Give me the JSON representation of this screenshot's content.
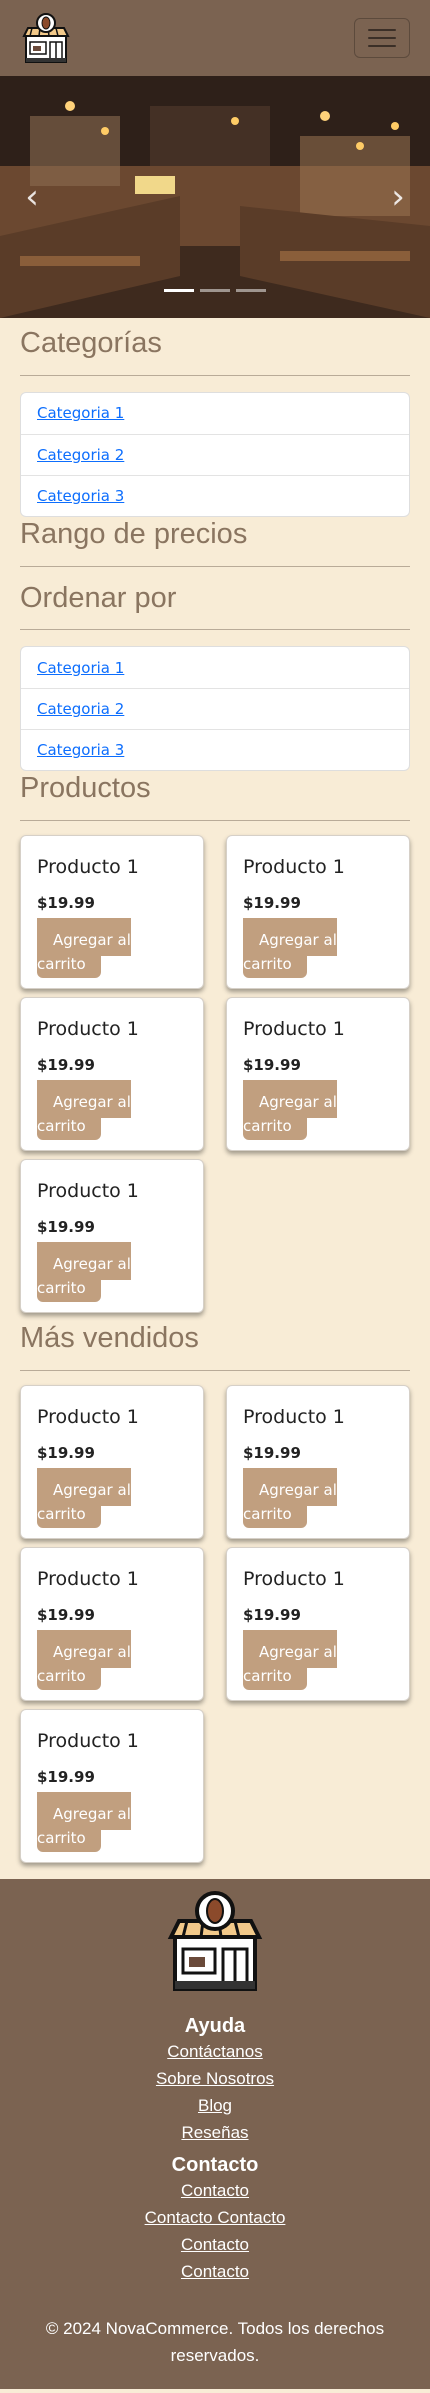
{
  "navbar": {
    "logo_icon": "coffee-shop-icon",
    "menu_icon": "hamburger-icon"
  },
  "carousel": {
    "prev_glyph": "‹",
    "next_glyph": "›",
    "slides": 3,
    "active_slide": 0
  },
  "categorias": {
    "title": "Categorías",
    "items": [
      "Categoria 1",
      "Categoria 2",
      "Categoria 3"
    ]
  },
  "rango_precios": {
    "title": "Rango de precios"
  },
  "ordenar": {
    "title": "Ordenar por",
    "items": [
      "Categoria 1",
      "Categoria 2",
      "Categoria 3"
    ]
  },
  "productos": {
    "title": "Productos",
    "items": [
      {
        "name": "Producto 1",
        "price": "$19.99",
        "button_l1": "Agregar al",
        "button_l2": "carrito"
      },
      {
        "name": "Producto 1",
        "price": "$19.99",
        "button_l1": "Agregar al",
        "button_l2": "carrito"
      },
      {
        "name": "Producto 1",
        "price": "$19.99",
        "button_l1": "Agregar al",
        "button_l2": "carrito"
      },
      {
        "name": "Producto 1",
        "price": "$19.99",
        "button_l1": "Agregar al",
        "button_l2": "carrito"
      },
      {
        "name": "Producto 1",
        "price": "$19.99",
        "button_l1": "Agregar al",
        "button_l2": "carrito"
      }
    ]
  },
  "mas_vendidos": {
    "title": "Más vendidos",
    "items": [
      {
        "name": "Producto 1",
        "price": "$19.99",
        "button_l1": "Agregar al",
        "button_l2": "carrito"
      },
      {
        "name": "Producto 1",
        "price": "$19.99",
        "button_l1": "Agregar al",
        "button_l2": "carrito"
      },
      {
        "name": "Producto 1",
        "price": "$19.99",
        "button_l1": "Agregar al",
        "button_l2": "carrito"
      },
      {
        "name": "Producto 1",
        "price": "$19.99",
        "button_l1": "Agregar al",
        "button_l2": "carrito"
      },
      {
        "name": "Producto 1",
        "price": "$19.99",
        "button_l1": "Agregar al",
        "button_l2": "carrito"
      }
    ]
  },
  "footer": {
    "ayuda_title": "Ayuda",
    "ayuda_links": [
      "Contáctanos",
      "Sobre Nosotros",
      "Blog",
      "Reseñas"
    ],
    "contacto_title": "Contacto",
    "contacto_links": [
      "Contacto",
      "Contacto Contacto",
      "Contacto",
      "Contacto"
    ],
    "copyright": "© 2024 NovaCommerce. Todos los derechos reservados."
  },
  "colors": {
    "navbar": "#7b6351",
    "page_bg": "#f8ecd6",
    "section_title": "#8a7560",
    "button": "#c19f7f",
    "link": "#0d6efd"
  }
}
